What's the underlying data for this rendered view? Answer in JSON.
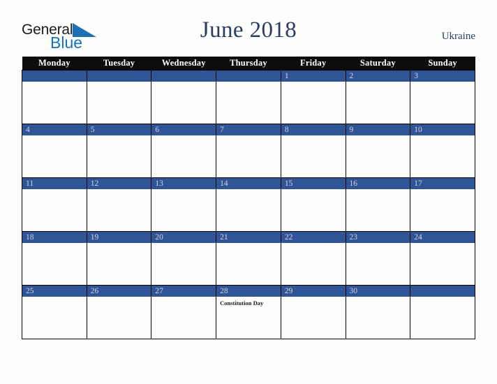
{
  "logo": {
    "word_black": "General",
    "word_blue": "Blue",
    "triangle_color": "#1f6fb5"
  },
  "header": {
    "title": "June 2018",
    "country": "Ukraine"
  },
  "colors": {
    "header_row_bg": "#0d0d0d",
    "date_band_bg": "#2f5597",
    "date_number": "#d3d3dd",
    "title_text": "#2b3c63",
    "page_bg": "#fdfdfd"
  },
  "calendar": {
    "weekday_headers": [
      "Monday",
      "Tuesday",
      "Wednesday",
      "Thursday",
      "Friday",
      "Saturday",
      "Sunday"
    ],
    "weeks": [
      [
        {
          "date": "",
          "events": []
        },
        {
          "date": "",
          "events": []
        },
        {
          "date": "",
          "events": []
        },
        {
          "date": "",
          "events": []
        },
        {
          "date": "1",
          "events": []
        },
        {
          "date": "2",
          "events": []
        },
        {
          "date": "3",
          "events": []
        }
      ],
      [
        {
          "date": "4",
          "events": []
        },
        {
          "date": "5",
          "events": []
        },
        {
          "date": "6",
          "events": []
        },
        {
          "date": "7",
          "events": []
        },
        {
          "date": "8",
          "events": []
        },
        {
          "date": "9",
          "events": []
        },
        {
          "date": "10",
          "events": []
        }
      ],
      [
        {
          "date": "11",
          "events": []
        },
        {
          "date": "12",
          "events": []
        },
        {
          "date": "13",
          "events": []
        },
        {
          "date": "14",
          "events": []
        },
        {
          "date": "15",
          "events": []
        },
        {
          "date": "16",
          "events": []
        },
        {
          "date": "17",
          "events": []
        }
      ],
      [
        {
          "date": "18",
          "events": []
        },
        {
          "date": "19",
          "events": []
        },
        {
          "date": "20",
          "events": []
        },
        {
          "date": "21",
          "events": []
        },
        {
          "date": "22",
          "events": []
        },
        {
          "date": "23",
          "events": []
        },
        {
          "date": "24",
          "events": []
        }
      ],
      [
        {
          "date": "25",
          "events": []
        },
        {
          "date": "26",
          "events": []
        },
        {
          "date": "27",
          "events": []
        },
        {
          "date": "28",
          "events": [
            "Constitution Day"
          ]
        },
        {
          "date": "29",
          "events": []
        },
        {
          "date": "30",
          "events": []
        },
        {
          "date": "",
          "events": []
        }
      ]
    ]
  }
}
